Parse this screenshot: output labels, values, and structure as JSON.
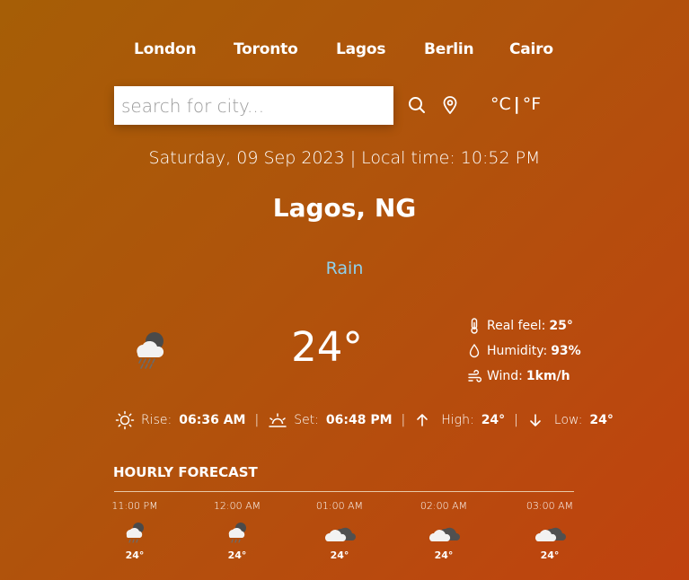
{
  "cities": [
    "London",
    "Toronto",
    "Lagos",
    "Berlin",
    "Cairo"
  ],
  "search": {
    "placeholder": "search for city..."
  },
  "units": {
    "celsius": "°C",
    "separator": "|",
    "fahrenheit": "°F"
  },
  "datetime": "Saturday, 09 Sep 2023 | Local time: 10:52 PM",
  "location": "Lagos, NG",
  "condition": "Rain",
  "temperature": "24°",
  "details": {
    "real_feel_label": "Real feel:",
    "real_feel": "25°",
    "humidity_label": "Humidity:",
    "humidity": "93%",
    "wind_label": "Wind:",
    "wind": "1km/h"
  },
  "sun": {
    "rise_label": "Rise:",
    "rise": "06:36 AM",
    "set_label": "Set:",
    "set": "06:48 PM",
    "high_label": "High:",
    "high": "24°",
    "low_label": "Low:",
    "low": "24°",
    "pipe": "|"
  },
  "forecast": {
    "title": "HOURLY FORECAST",
    "items": [
      {
        "time": "11:00 PM",
        "temp": "24°",
        "icon": "rain-cloud-icon"
      },
      {
        "time": "12:00 AM",
        "temp": "24°",
        "icon": "rain-cloud-icon"
      },
      {
        "time": "01:00 AM",
        "temp": "24°",
        "icon": "cloud-icon"
      },
      {
        "time": "02:00 AM",
        "temp": "24°",
        "icon": "cloud-icon"
      },
      {
        "time": "03:00 AM",
        "temp": "24°",
        "icon": "cloud-icon"
      }
    ]
  }
}
